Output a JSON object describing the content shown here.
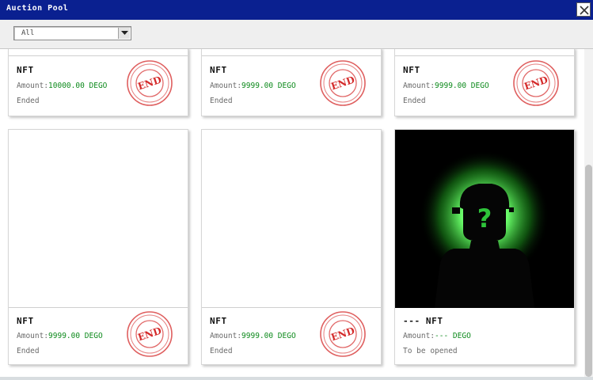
{
  "window": {
    "title": "Auction Pool",
    "close_icon": "close-icon"
  },
  "filter": {
    "selected": "All",
    "arrow_icon": "chevron-down-icon"
  },
  "stamp_text": "END",
  "cards": [
    {
      "name": "NFT",
      "amount_label": "Amount:",
      "amount_value": "10000.00 DEGO",
      "status": "Ended"
    },
    {
      "name": "NFT",
      "amount_label": "Amount:",
      "amount_value": "9999.00 DEGO",
      "status": "Ended"
    },
    {
      "name": "NFT",
      "amount_label": "Amount:",
      "amount_value": "9999.00 DEGO",
      "status": "Ended"
    },
    {
      "name": "NFT",
      "amount_label": "Amount:",
      "amount_value": "9999.00 DEGO",
      "status": "Ended"
    },
    {
      "name": "NFT",
      "amount_label": "Amount:",
      "amount_value": "9999.00 DEGO",
      "status": "Ended"
    },
    {
      "name": "--- NFT",
      "amount_label": "Amount:",
      "amount_value": "--- DEGO",
      "status": "To be opened",
      "image": "mystery-figure-glow"
    }
  ],
  "colors": {
    "titlebar": "#0a2090",
    "amount_value": "#0d8a1c",
    "stamp": "#d42a2a",
    "glow": "#6bff6b"
  }
}
